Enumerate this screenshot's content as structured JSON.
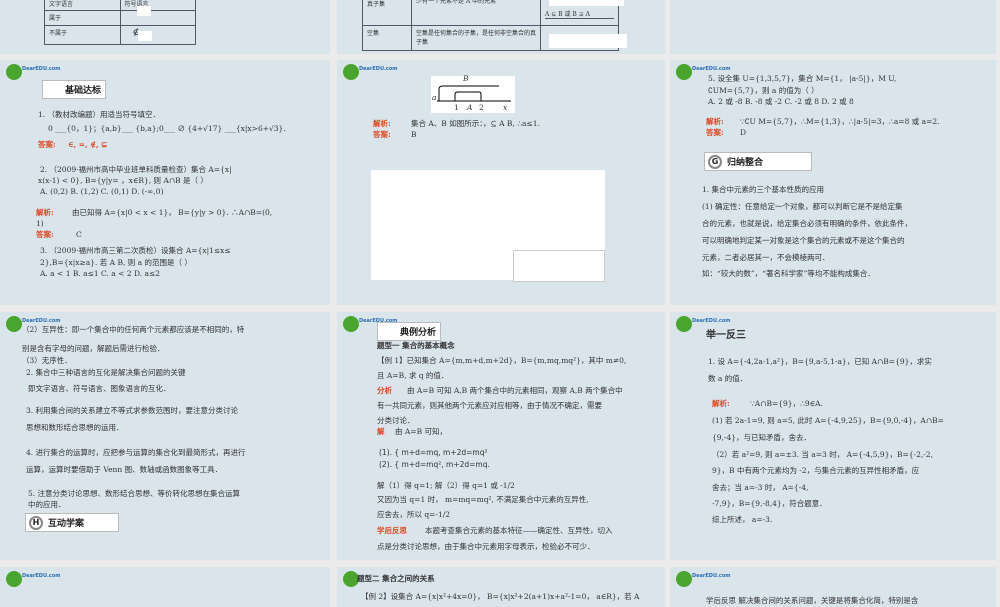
{
  "logo_text": "DearEDU.com",
  "s0": {
    "h1": "文字语言",
    "h2": "符号语言",
    "r1": "属于",
    "r2": "不属于",
    "sym2": "∉"
  },
  "s1": {
    "r1a": "真子集",
    "r1b": "A 中任意一个元素均为 B 中的元素，B 中至少有一个元素不是 A 中的元素",
    "r1c": "A ⊊ B 或 B ⊋ A",
    "r2a": "空集",
    "r2b": "空集是任何集合的子集，是任何非空集合的真子集"
  },
  "s3": {
    "badge": "基础达标",
    "q1": "1. （教材改编题）用适当符号填空．",
    "q1b": "0 ___{0，1}；{a,b}___ {b,a};0___ ∅ {4+√17} ___{x|x>6+√3}.",
    "ans_label": "答案:",
    "ans1": "∈, =, ∉, ⊊",
    "q2a": "2. （2009·福州市高中毕业班单科质量检查）集合 A={x|",
    "q2b": "x(x-1) < 0}, B={y|y= ，x∈R}, 则 A∩B 是（ ）",
    "q2c": "A. (0,2)  B. (1,2)  C. (0,1)  D. (-∞,0)",
    "jx_label": "解析:",
    "jx2": "由已知得 A={x|0 < x < 1}， B={y|y > 0}. ∴A∩B=(0,",
    "jx2b": "1)",
    "ans2": "C",
    "q3a": "3. （2009·福州市高三第二次质检）设集合 A={x|1≤x≤",
    "q3b": "2},B={x|x≥a}. 若 A  B, 则 a 的范围是（ ）",
    "q3c": "A. a < 1  B. a≤1  C. a < 2  D. a≤2"
  },
  "s4": {
    "fig_B": "B",
    "fig_a": "a",
    "fig_1": "1",
    "fig_A": "A",
    "fig_2": "2",
    "fig_x": "x",
    "jx_label": "解析:",
    "jx": "集合 A、B 如图所示：，⊆ A  B, ∴a≤1.",
    "ans_label": "答案:",
    "ans": "B"
  },
  "s5": {
    "q5a": "5. 设全集 U={1,3,5,7}，集合 M={1， |a-5|}，M  U,",
    "q5b": "∁UM={5,7}，则 a 的值为（ ）",
    "q5c": "A. 2 或 -8  B. -8 或 -2  C. -2 或 8  D. 2 或 8",
    "jx_label": "解析:",
    "jx": "∵∁U M={5,7}，∴M={1,3}，∴|a-5|=3，∴a=8 或 a=2.",
    "ans_label": "答案:",
    "ans": "D",
    "badge": "归纳整合",
    "l1": "1. 集合中元素的三个基本性质的应用",
    "l2": "(1) 确定性：任意给定一个对象，都可以判断它是不是给定集",
    "l3": "合的元素，也就是说，给定集合必须有明确的条件，依此条件，",
    "l4": "可以明确地判定某一对象是这个集合的元素或不是这个集合的",
    "l5": "元素，二者必居其一，不会模棱两可．",
    "l6": "如：“较大的数”，“著名科学家”等均不能构成集合．"
  },
  "s6": {
    "l1": "（2）互异性：即一个集合中的任何两个元素都应该是不相同的，特",
    "l2": "别是含有字母的问题，解题后需进行检验．",
    "l3": "（3）无序性．",
    "l4": "2. 集合中三种语言的互化是解决集合问题的关键",
    "l5": "即文字语言、符号语言、图象语言的互化．",
    "l6": "3. 利用集合间的关系建立不等式求参数范围时，要注意分类讨论",
    "l7": "思想和数形结合思想的运用．",
    "l8": "4. 进行集合的运算时，应把参与运算的集合化到最简形式，再进行",
    "l9": "运算，运算时要借助于 Venn 图、数轴或函数图象等工具．",
    "l10": "5. 注意分类讨论思想、数形结合思想、等价转化思想在集合运算",
    "l11": "中的应用．",
    "badge": "互动学案"
  },
  "s7": {
    "badge": "典例分析",
    "title": "题型一  集合的基本概念",
    "l1": "【例 1】已知集合 A={m,m+d,m+2d}，B={m,mq,mq²}，其中 m≠0,",
    "l2": "且 A=B, 求 q 的值．",
    "fx": "分析",
    "l3": "由 A=B 可知 A,B 两个集合中的元素相同，观察 A,B 两个集合中",
    "l4": "有一共同元素，则其他两个元素应对应相等，由于情况不确定，需要",
    "l5": "分类讨论．",
    "jie": "解",
    "l6": "由 A=B 可知，",
    "eq1": "(1). { m+d=mq,  m+2d=mq²",
    "eq2": "(2). { m+d=mq²,  m+2d=mq.",
    "l7": "解（1）得 q=1; 解（2）得 q=1 或 -1/2",
    "l8": "又因为当 q=1 时， m=mq=mq², 不满足集合中元素的互异性,",
    "l9": "应舍去，所以 q=-1/2",
    "fs": "学后反思",
    "l10": "本题考查集合元素的基本特征——确定性、互异性，切入",
    "l11": "点是分类讨论思想，由于集合中元素用字母表示，检验必不可少．"
  },
  "s8": {
    "title": "举一反三",
    "l1": "1. 设 A={-4,2a-1,a²}，B={9,a-5,1-a}，已知 A∩B={9}，求实",
    "l2": "数 a 的值．",
    "jx_label": "解析:",
    "l3": "∵A∩B={9}，∴9∈A.",
    "l4": "(1) 若 2a-1=9, 则 a=5, 此时 A={-4,9,25}，B={9,0,-4}，A∩B=",
    "l5": "{9,-4}，与已知矛盾，舍去．",
    "l6": "（2）若 a²=9, 则 a=±3. 当 a=3 时， A={-4,5,9}，B={-2,-2,",
    "l7": "9}，B 中有两个元素均为 -2，与集合元素的互异性相矛盾，应",
    "l8": "舍去；当 a=-3 时， A={-4,",
    "l9": "-7,9}，B={9,-8,4}，符合题意．",
    "l10": "综上所述， a=-3."
  },
  "s10": {
    "title": "题型二    集合之间的关系",
    "l1": "【例 2】设集合 A={x|x²+4x=0}， B={x|x²+2(a+1)x+a²-1=0， a∈R}，若 A"
  },
  "s11": {
    "l1": "学后反思  解决集合间的关系问题，关键是将集合化简，特别是含"
  }
}
